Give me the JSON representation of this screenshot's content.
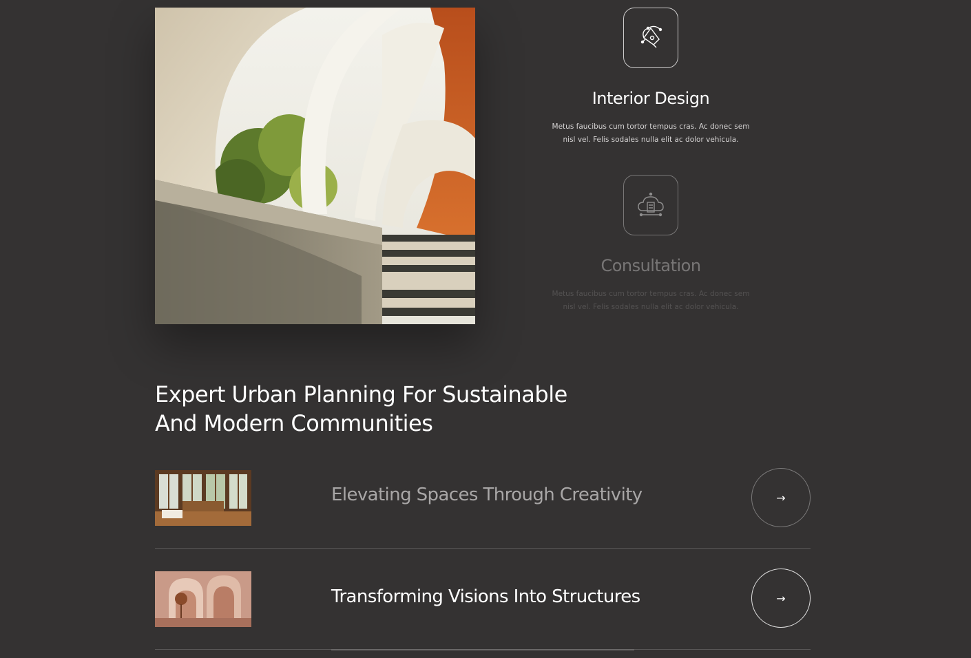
{
  "services": [
    {
      "title": "Interior Design",
      "description": "Metus faucibus cum tortor tempus cras. Ac donec sem nisl vel. Felis sodales nulla elit ac dolor vehicula.",
      "icon": "pen-tool-icon"
    },
    {
      "title": "Consultation",
      "description": "Metus faucibus cum tortor tempus cras. Ac donec sem nisl vel. Felis sodales nulla elit ac dolor vehicula.",
      "icon": "cloud-building-icon"
    }
  ],
  "headline": {
    "line1": "Expert Urban Planning For Sustainable",
    "line2": "And Modern Communities"
  },
  "projects": [
    {
      "title": "Elevating Spaces Through Creativity",
      "arrow": "→"
    },
    {
      "title": "Transforming Visions Into Structures",
      "arrow": "→"
    }
  ],
  "colors": {
    "background": "#343232",
    "accent_orange": "#c65a22",
    "text": "#ffffff"
  }
}
